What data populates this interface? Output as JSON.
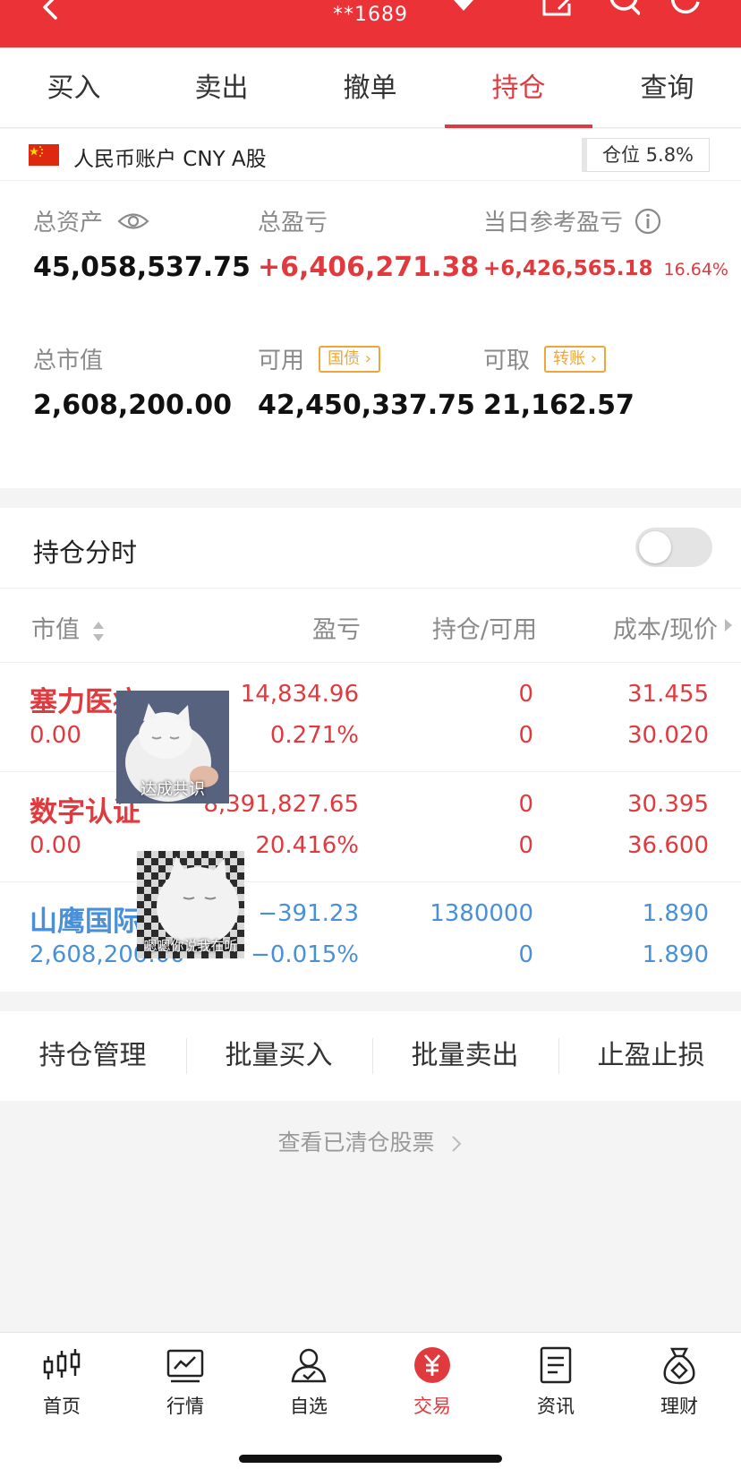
{
  "header": {
    "account_masked": "**1689"
  },
  "tabs": [
    {
      "label": "买入",
      "active": false
    },
    {
      "label": "卖出",
      "active": false
    },
    {
      "label": "撤单",
      "active": false
    },
    {
      "label": "持仓",
      "active": true
    },
    {
      "label": "查询",
      "active": false
    }
  ],
  "account": {
    "label": "人民币账户 CNY A股",
    "position_label": "仓位 5.8%"
  },
  "summary": {
    "total_assets_label": "总资产",
    "total_assets": "45,058,537.75",
    "total_pl_label": "总盈亏",
    "total_pl": "+6,406,271.38",
    "daily_pl_label": "当日参考盈亏",
    "daily_pl": "+6,426,565.18",
    "daily_pl_pct": "16.64%",
    "market_value_label": "总市值",
    "market_value": "2,608,200.00",
    "available_label": "可用",
    "available": "42,450,337.75",
    "bond_tag": "国债",
    "withdrawable_label": "可取",
    "withdrawable": "21,162.57",
    "transfer_tag": "转账"
  },
  "holdings": {
    "title": "持仓分时",
    "columns": {
      "market_value": "市值",
      "pl": "盈亏",
      "position": "持仓/可用",
      "cost": "成本/现价"
    },
    "rows": [
      {
        "name": "塞力医疗",
        "market_value": "0.00",
        "pl": "14,834.96",
        "pl_pct": "0.271%",
        "position": "0",
        "available": "0",
        "cost": "31.455",
        "price": "30.020",
        "color": "red"
      },
      {
        "name": "数字认证",
        "market_value": "0.00",
        "pl": "8,391,827.65",
        "pl_pct": "20.416%",
        "position": "0",
        "available": "0",
        "cost": "30.395",
        "price": "36.600",
        "color": "red"
      },
      {
        "name": "山鹰国际",
        "market_value": "2,608,200.00",
        "pl": "−391.23",
        "pl_pct": "−0.015%",
        "position": "1380000",
        "available": "0",
        "cost": "1.890",
        "price": "1.890",
        "color": "blue"
      }
    ],
    "memes": [
      "达成共识",
      "嗯嗯你说我在听"
    ]
  },
  "actions": [
    "持仓管理",
    "批量买入",
    "批量卖出",
    "止盈止损"
  ],
  "cleared_link": "查看已清仓股票",
  "bottom_nav": [
    {
      "label": "首页",
      "icon": "candlestick-icon"
    },
    {
      "label": "行情",
      "icon": "chart-icon"
    },
    {
      "label": "自选",
      "icon": "person-icon"
    },
    {
      "label": "交易",
      "icon": "yuan-icon",
      "active": true
    },
    {
      "label": "资讯",
      "icon": "document-icon"
    },
    {
      "label": "理财",
      "icon": "money-bag-icon"
    }
  ],
  "colors": {
    "brand_red": "#ea3237",
    "loss_blue": "#4a90d9",
    "tag_orange": "#f0a637"
  }
}
